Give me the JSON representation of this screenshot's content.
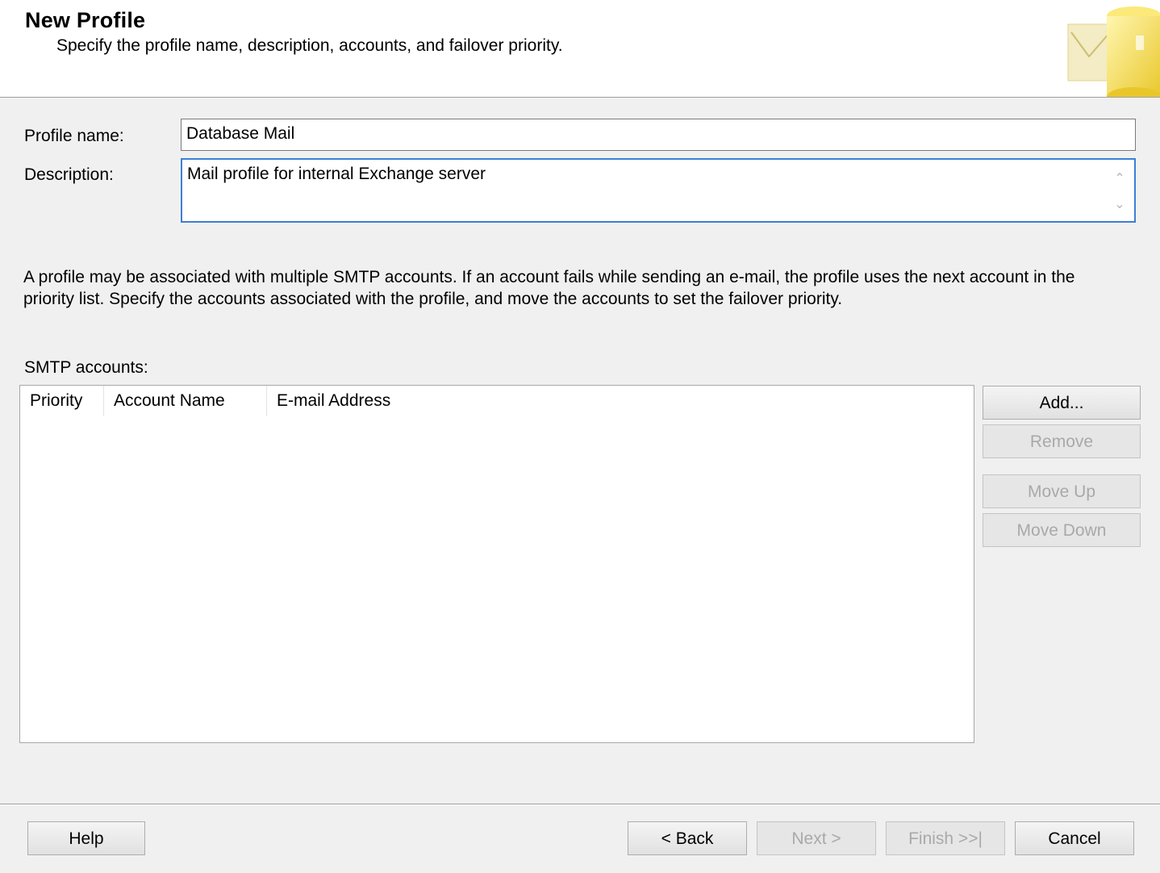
{
  "header": {
    "title": "New Profile",
    "subtitle": "Specify the profile name, description, accounts, and failover priority."
  },
  "form": {
    "profile_name_label": "Profile name:",
    "profile_name_value": "Database Mail",
    "description_label": "Description:",
    "description_value": "Mail profile for internal Exchange server"
  },
  "info": "A profile may be associated with multiple SMTP accounts. If an account fails while sending an e-mail, the profile uses the next account in the priority list. Specify the accounts associated with the profile, and move the accounts to set the failover priority.",
  "smtp": {
    "label": "SMTP accounts:",
    "columns": [
      "Priority",
      "Account Name",
      "E-mail Address"
    ],
    "rows": []
  },
  "side_buttons": {
    "add": "Add...",
    "remove": "Remove",
    "move_up": "Move Up",
    "move_down": "Move Down"
  },
  "footer": {
    "help": "Help",
    "back": "< Back",
    "next": "Next >",
    "finish": "Finish >>|",
    "cancel": "Cancel"
  },
  "colors": {
    "focus_border": "#3c7fd6",
    "disabled_text": "#a9a9a9"
  }
}
